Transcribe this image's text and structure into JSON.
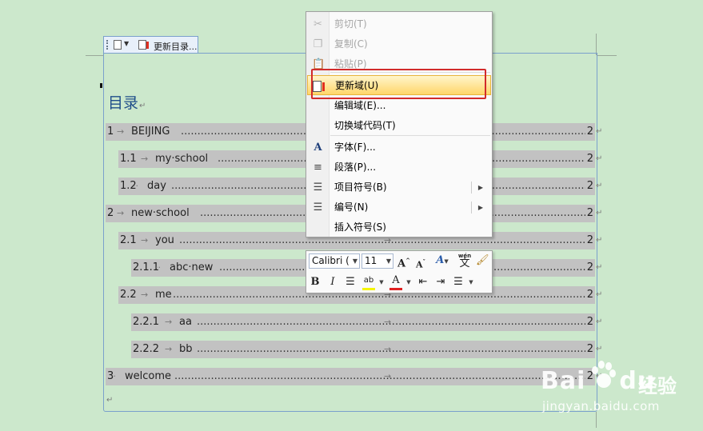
{
  "field_toolbar": {
    "update_label": "更新目录..."
  },
  "toc": {
    "title": "目录",
    "entries": [
      {
        "num": "1",
        "sep": "→",
        "text": "BEIJING",
        "page": "2"
      },
      {
        "num": "1.1",
        "sep": "→",
        "text": "my·school",
        "page": "2"
      },
      {
        "num": "1.2",
        "sep": "··",
        "text": "day",
        "page": "2"
      },
      {
        "num": "2",
        "sep": "→",
        "text": "new·school",
        "page": "2"
      },
      {
        "num": "2.1",
        "sep": "→",
        "text": "you",
        "page": "2"
      },
      {
        "num": "2.1.1",
        "sep": "··",
        "text": "abc·new",
        "page": "2"
      },
      {
        "num": "2.2",
        "sep": "→",
        "text": "me",
        "page": "2"
      },
      {
        "num": "2.2.1",
        "sep": "→",
        "text": "aa",
        "page": "2"
      },
      {
        "num": "2.2.2",
        "sep": "→",
        "text": "bb",
        "page": "2"
      },
      {
        "num": "3",
        "sep": "··",
        "text": "welcome",
        "page": "2"
      }
    ]
  },
  "context_menu": {
    "items": [
      {
        "label": "剪切(T)",
        "icon": "scissors-icon",
        "glyph": "✂",
        "disabled": true
      },
      {
        "label": "复制(C)",
        "icon": "copy-icon",
        "glyph": "❐",
        "disabled": true
      },
      {
        "label": "粘贴(P)",
        "icon": "paste-icon",
        "glyph": "📋",
        "disabled": true
      },
      {
        "label": "更新域(U)",
        "icon": "update-field-icon",
        "glyph": "",
        "disabled": false,
        "highlighted": true
      },
      {
        "label": "编辑域(E)...",
        "icon": "",
        "glyph": "",
        "disabled": false
      },
      {
        "label": "切换域代码(T)",
        "icon": "",
        "glyph": "",
        "disabled": false
      },
      {
        "label": "字体(F)...",
        "icon": "font-icon",
        "glyph": "A",
        "disabled": false
      },
      {
        "label": "段落(P)...",
        "icon": "paragraph-icon",
        "glyph": "≡",
        "disabled": false
      },
      {
        "label": "项目符号(B)",
        "icon": "bullets-icon",
        "glyph": "☰",
        "disabled": false,
        "submenu": true
      },
      {
        "label": "编号(N)",
        "icon": "numbering-icon",
        "glyph": "☰",
        "disabled": false,
        "submenu": true
      },
      {
        "label": "插入符号(S)",
        "icon": "",
        "glyph": "",
        "disabled": false
      }
    ]
  },
  "mini_toolbar": {
    "font_name": "Calibri (",
    "font_size": "11",
    "grow_font": "A",
    "shrink_font": "A",
    "styles": "A",
    "phonetic_top": "wén",
    "phonetic_char": "文",
    "bold": "B",
    "italic": "I",
    "highlight_text": "ab",
    "font_color_letter": "A",
    "highlight_color": "#f5f500",
    "font_color": "#e02020"
  },
  "watermark": {
    "logo": "Bai",
    "logo_tail": "du",
    "cn": "经验",
    "url": "jingyan.baidu.com"
  }
}
